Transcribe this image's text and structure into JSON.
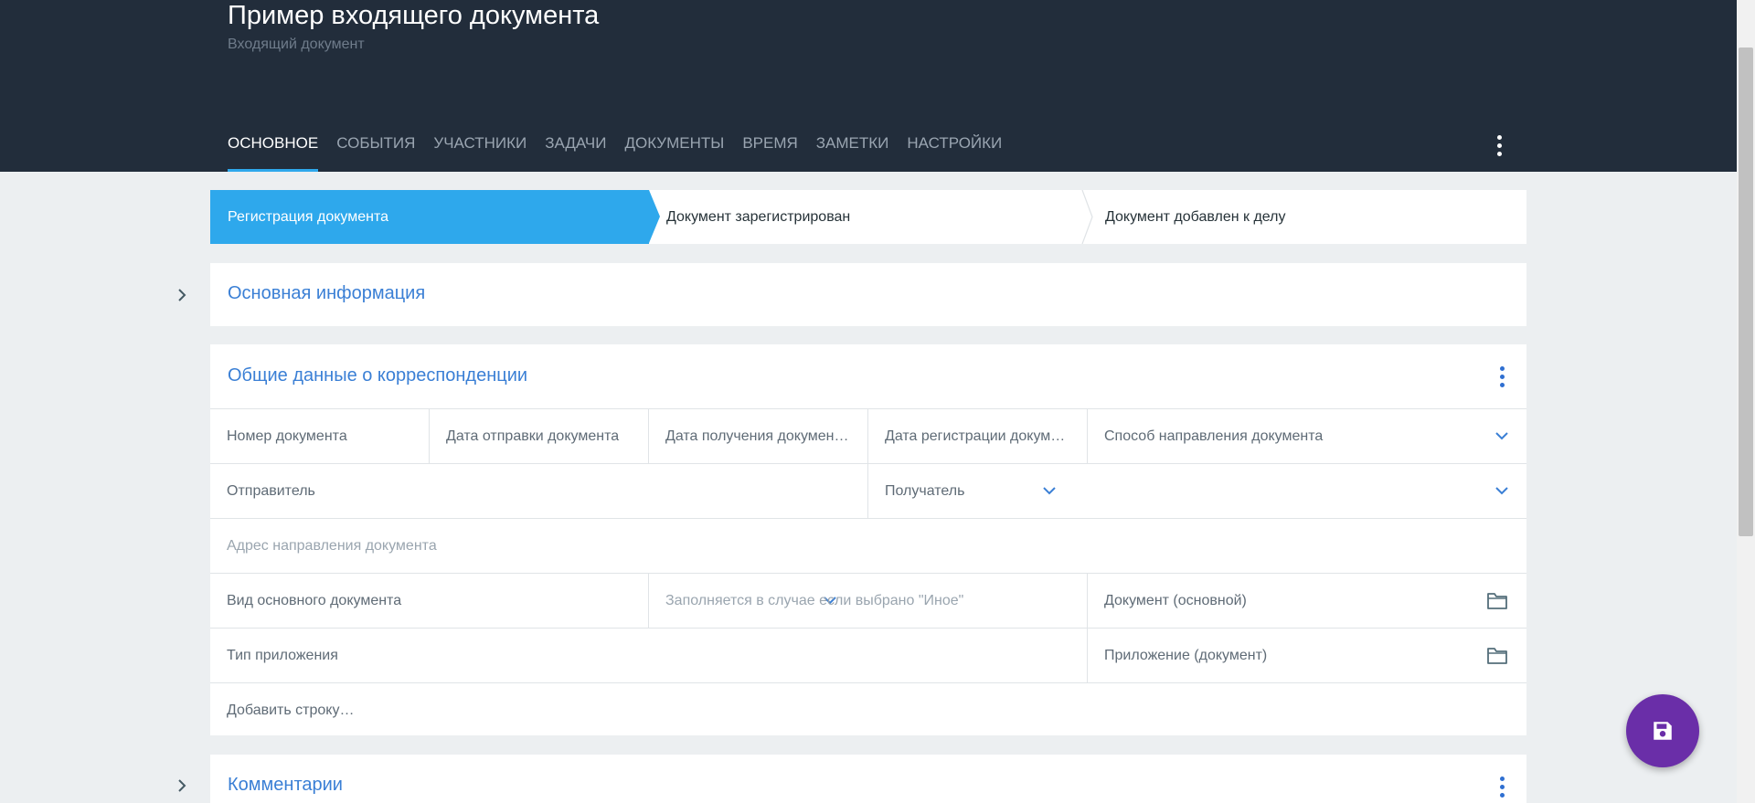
{
  "document": {
    "title": "Пример входящего документа",
    "subtitle": "Входящий документ"
  },
  "tabs": [
    {
      "label": "ОСНОВНОЕ",
      "active": true
    },
    {
      "label": "СОБЫТИЯ"
    },
    {
      "label": "УЧАСТНИКИ"
    },
    {
      "label": "ЗАДАЧИ"
    },
    {
      "label": "ДОКУМЕНТЫ"
    },
    {
      "label": "ВРЕМЯ"
    },
    {
      "label": "ЗАМЕТКИ"
    },
    {
      "label": "НАСТРОЙКИ"
    }
  ],
  "stepper": [
    {
      "label": "Регистрация документа",
      "active": true
    },
    {
      "label": "Документ зарегистрирован"
    },
    {
      "label": "Документ добавлен к делу"
    }
  ],
  "sections": {
    "main_info": {
      "title": "Основная информация"
    },
    "correspondence": {
      "title": "Общие данные о корреспонденции",
      "fields": {
        "doc_number": "Номер документа",
        "send_date": "Дата отправки документа",
        "receive_date": "Дата получения докумен…",
        "register_date": "Дата регистрации докум…",
        "delivery_method": "Способ направления документа",
        "sender": "Отправитель",
        "recipient": "Получатель",
        "address_placeholder": "Адрес направления документа",
        "main_doc_type": "Вид основного документа",
        "other_placeholder": "Заполняется в случае если выбрано \"Иное\"",
        "main_doc": "Документ (основной)",
        "attachment_type": "Тип приложения",
        "attachment_doc": "Приложение (документ)",
        "add_row": "Добавить строку…"
      }
    },
    "comments": {
      "title": "Комментарии"
    }
  },
  "icons": {
    "expand": "chevron-right-icon",
    "menu": "more-vert-icon",
    "dropdown": "chevron-down-icon",
    "folder": "folder-icon",
    "save": "save-icon"
  },
  "colors": {
    "header_bg": "#222d3b",
    "accent": "#2ea8ec",
    "link": "#3a7fd5",
    "fab": "#6a2ea8"
  }
}
